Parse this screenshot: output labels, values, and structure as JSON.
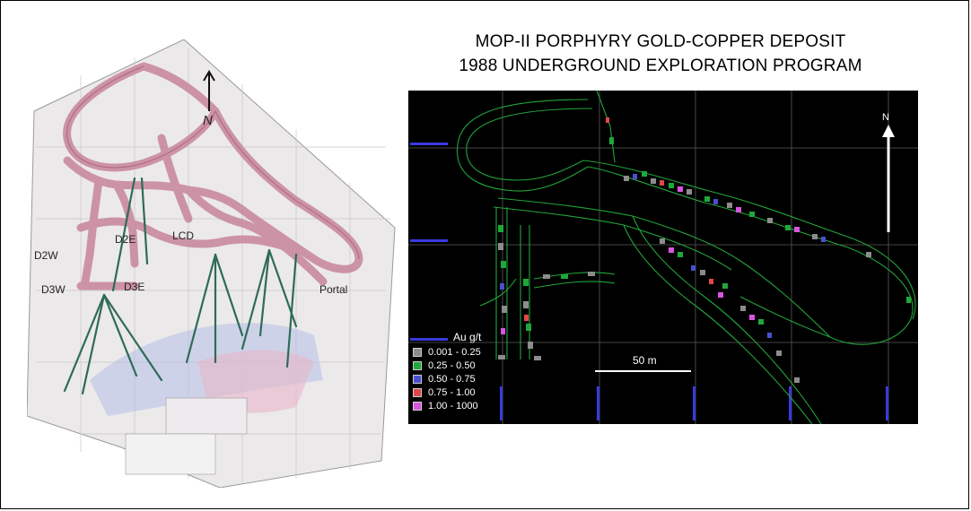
{
  "title": {
    "line1": "MOP-II PORPHYRY GOLD-COPPER DEPOSIT",
    "line2": "1988 UNDERGROUND EXPLORATION PROGRAM"
  },
  "left_map": {
    "labels": {
      "d2w": "D2W",
      "d3w": "D3W",
      "d2e": "D2E",
      "d3e": "D3E",
      "lcd": "LCD",
      "portal": "Portal",
      "north": "N"
    }
  },
  "right_map": {
    "north": "N",
    "scale": "50 m",
    "legend": {
      "title": "Au g/t",
      "items": [
        {
          "label": "0.001 - 0.25",
          "color": "#8c8c8c"
        },
        {
          "label": "0.25 - 0.50",
          "color": "#1fa83a"
        },
        {
          "label": "0.50 - 0.75",
          "color": "#4a4fd0"
        },
        {
          "label": "0.75 - 1.00",
          "color": "#e04848"
        },
        {
          "label": "1.00 - 1000",
          "color": "#d855e0"
        }
      ]
    }
  }
}
